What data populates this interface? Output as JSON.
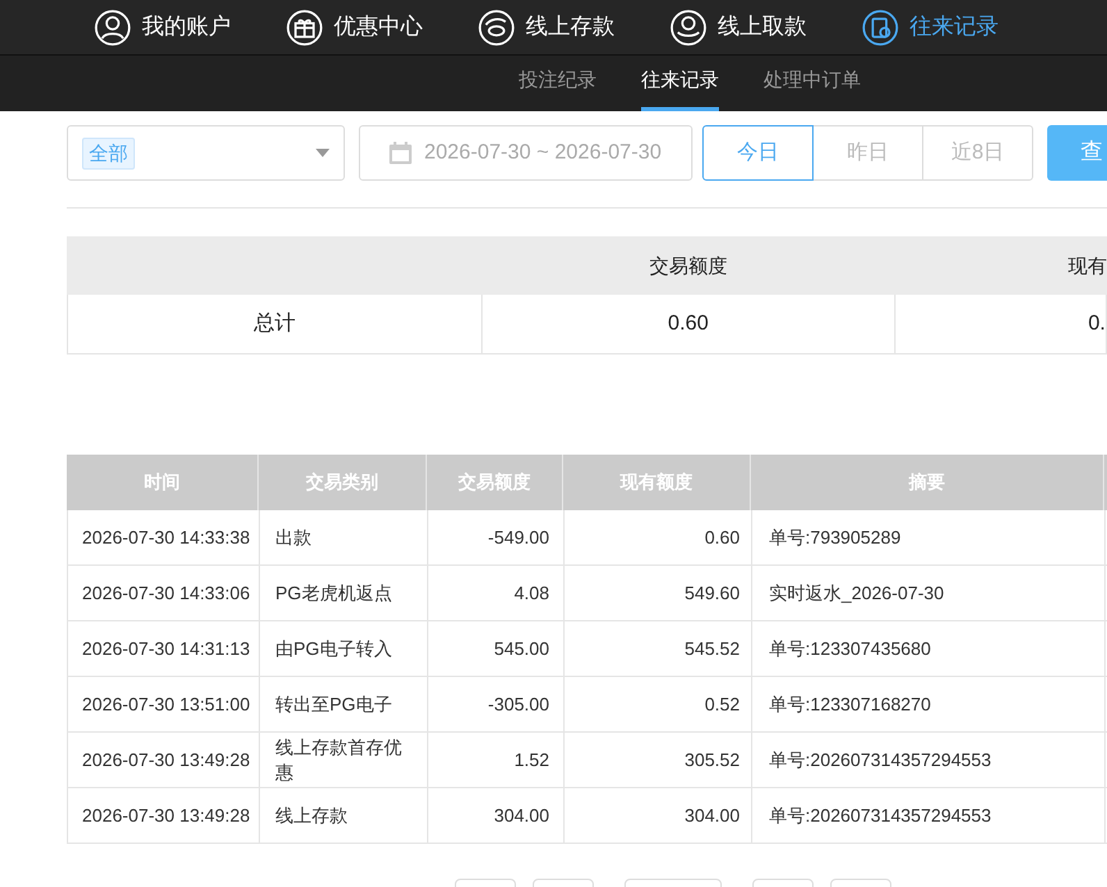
{
  "nav": [
    {
      "label": "我的账户",
      "kind": "user",
      "selected": false
    },
    {
      "label": "优惠中心",
      "kind": "gift",
      "selected": false
    },
    {
      "label": "线上存款",
      "kind": "deposit",
      "selected": false
    },
    {
      "label": "线上取款",
      "kind": "withdraw",
      "selected": false
    },
    {
      "label": "往来记录",
      "kind": "record",
      "selected": true
    }
  ],
  "subtabs": [
    {
      "label": "投注纪录",
      "selected": false
    },
    {
      "label": "往来记录",
      "selected": true
    },
    {
      "label": "处理中订单",
      "selected": false
    }
  ],
  "filter": {
    "type_tag": "全部",
    "date_range": "2026-07-30 ~ 2026-07-30",
    "ranges": [
      {
        "label": "今日",
        "selected": true
      },
      {
        "label": "昨日",
        "selected": false
      },
      {
        "label": "近8日",
        "selected": false
      }
    ],
    "query_button": "查"
  },
  "summary": {
    "columns": [
      "",
      "交易额度",
      "现有"
    ],
    "row": [
      "总计",
      "0.60",
      "0."
    ]
  },
  "table": {
    "columns": [
      "时间",
      "交易类别",
      "交易额度",
      "现有额度",
      "摘要"
    ],
    "rows": [
      [
        "2026-07-30 14:33:38",
        "出款",
        "-549.00",
        "0.60",
        "单号:793905289"
      ],
      [
        "2026-07-30 14:33:06",
        "PG老虎机返点",
        "4.08",
        "549.60",
        "实时返水_2026-07-30"
      ],
      [
        "2026-07-30 14:31:13",
        "由PG电子转入",
        "545.00",
        "545.52",
        "单号:123307435680"
      ],
      [
        "2026-07-30 13:51:00",
        "转出至PG电子",
        "-305.00",
        "0.52",
        "单号:123307168270"
      ],
      [
        "2026-07-30 13:49:28",
        "线上存款首存优惠",
        "1.52",
        "305.52",
        "单号:202607314357294553"
      ],
      [
        "2026-07-30 13:49:28",
        "线上存款",
        "304.00",
        "304.00",
        "单号:202607314357294553"
      ]
    ]
  }
}
